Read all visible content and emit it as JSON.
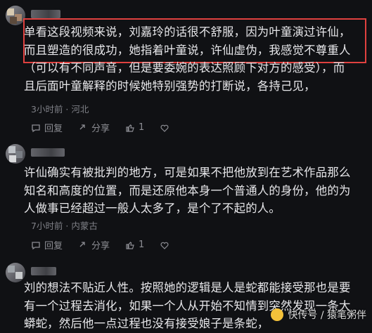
{
  "comments": [
    {
      "lines": [
        "单看这段视频来说，刘嘉玲的话很不舒服，因为叶童演过许仙，",
        "而且塑造的很成功，她指着叶童说，许仙虚伪，我感觉不尊重人",
        "（可以有不同声音，但是要委婉的表达照顾下对方的感受），而",
        "且后面叶童解释的时候她特别强势的打断说，各持己见，"
      ],
      "meta": "3小时前 · 河北",
      "reply": "回复",
      "share": "分享",
      "likes": "1"
    },
    {
      "lines": [
        "许仙确实有被批判的地方，可是如果不把他放到在艺术作品那么",
        "知名和高度的位置，而是还原他本身一个普通人的身份，他的为",
        "人做事已经超过一般人太多了，是个了不起的人。"
      ],
      "meta": "7小时前 · 内蒙古",
      "reply": "回复",
      "share": "分享",
      "likes": "1"
    },
    {
      "lines": [
        "刘的想法不贴近人性。按照她的逻辑是人是蛇都能接受那也是要",
        "有一个过程去消化，如果一个人从开始不知情到突然发现一条大",
        "蟒蛇，然后他一点过程也没有接受娘子是条蛇，"
      ]
    }
  ],
  "watermark": "快传号 / 猿笔粥伴",
  "colors": {
    "highlight_border": "#e0413f",
    "background": "#101114"
  }
}
